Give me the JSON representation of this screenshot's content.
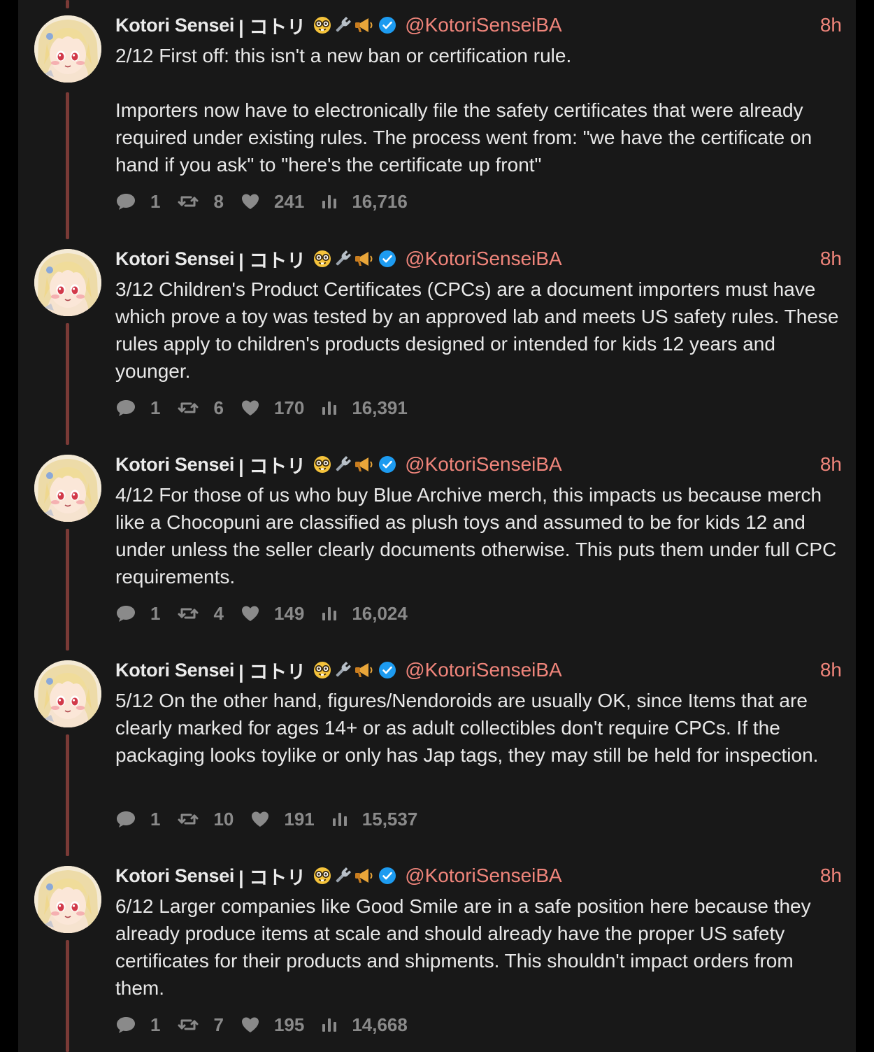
{
  "author": {
    "display_name": "Kotori Sensei",
    "name_suffix": "| コトリ",
    "handle": "@KotoriSenseiBA",
    "emoji_icons": [
      "nerd-face-icon",
      "wrench-icon",
      "megaphone-icon"
    ],
    "verified": true
  },
  "colors": {
    "background": "#000000",
    "column": "#181818",
    "accent": "#f0857b",
    "thread_line": "#7a3a36",
    "text": "#e8e8e8",
    "muted": "#8a8a8a",
    "verified_badge": "#1d9bf0"
  },
  "tweets": [
    {
      "time": "8h",
      "text": "2/12 First off: this isn't a new ban or certification rule.\n\nImporters now have to electronically file the safety certificates that were already required under existing rules. The process went from: \"we have the certificate on hand if you ask\" to \"here's the certificate up front\"",
      "replies": "1",
      "reposts": "8",
      "likes": "241",
      "views": "16,716"
    },
    {
      "time": "8h",
      "text": "3/12 Children's Product Certificates (CPCs) are a document importers must have which prove a toy was tested by an approved lab and meets US safety rules. These rules apply to children's products designed or intended for kids 12 years and younger.",
      "replies": "1",
      "reposts": "6",
      "likes": "170",
      "views": "16,391"
    },
    {
      "time": "8h",
      "text": "4/12 For those of us who buy Blue Archive merch, this impacts us because merch like a Chocopuni are classified as plush toys and assumed to be for kids 12 and under unless the seller clearly documents otherwise. This puts them under full CPC requirements.",
      "replies": "1",
      "reposts": "4",
      "likes": "149",
      "views": "16,024"
    },
    {
      "time": "8h",
      "text": "5/12 On the other hand, figures/Nendoroids are usually OK, since Items that are clearly marked for ages 14+ or as adult collectibles don't require CPCs. If the packaging looks toylike or only has Jap tags, they may still be held for inspection.",
      "replies": "1",
      "reposts": "10",
      "likes": "191",
      "views": "15,537"
    },
    {
      "time": "8h",
      "text": "6/12 Larger companies like Good Smile are in a safe position here because they already produce items at scale and should already have the proper US safety certificates for their products and shipments. This shouldn't impact orders from them.",
      "replies": "1",
      "reposts": "7",
      "likes": "195",
      "views": "14,668"
    }
  ]
}
